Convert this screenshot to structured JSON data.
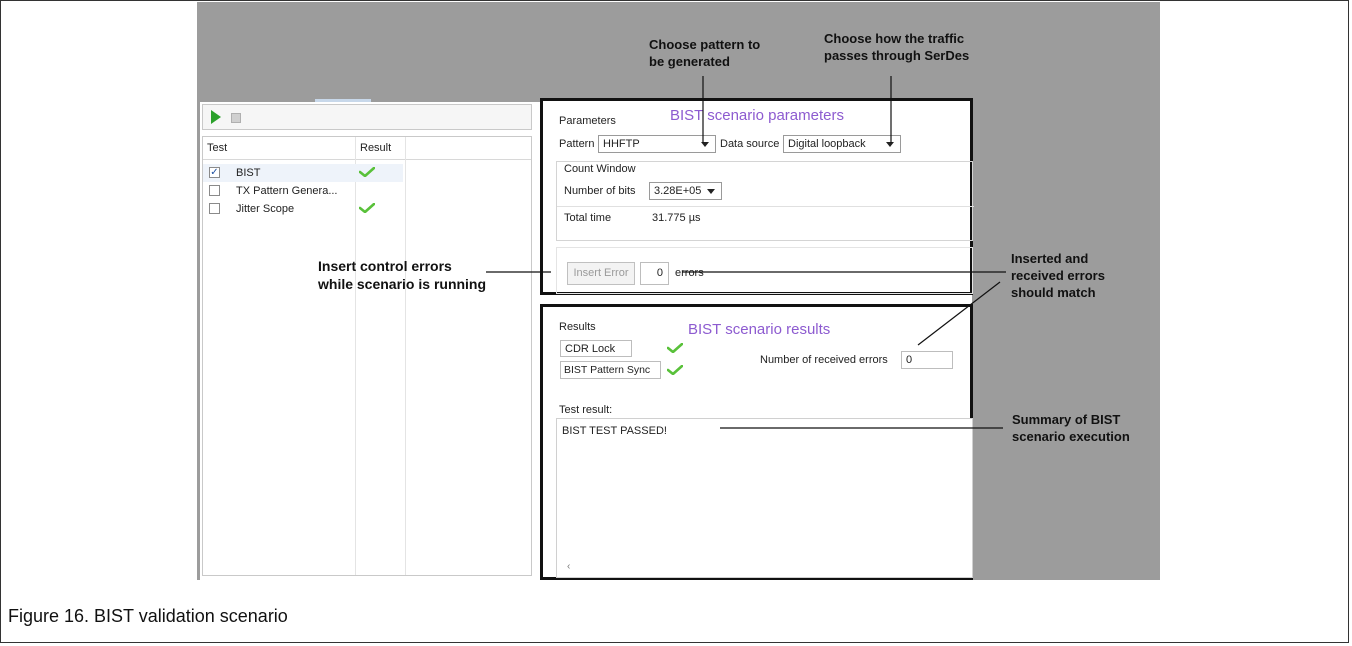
{
  "caption": "Figure 16.  BIST validation scenario",
  "annotations": {
    "choose_pattern": [
      "Choose pattern to",
      "be generated"
    ],
    "choose_traffic": [
      "Choose how the traffic",
      "passes through SerDes"
    ],
    "insert_control": [
      "Insert control errors",
      "while scenario is running"
    ],
    "inserted_received": [
      "Inserted and",
      "received errors",
      "should match"
    ],
    "summary": [
      "Summary of BIST",
      "scenario execution"
    ]
  },
  "test_panel": {
    "col_test": "Test",
    "col_result": "Result",
    "rows": [
      {
        "name": "BIST",
        "checked": true,
        "result": "pass"
      },
      {
        "name": "TX Pattern Genera...",
        "checked": false,
        "result": ""
      },
      {
        "name": "Jitter Scope",
        "checked": false,
        "result": "pass"
      }
    ]
  },
  "parameters": {
    "section_label": "Parameters",
    "title": "BIST scenario parameters",
    "pattern_label": "Pattern",
    "pattern_value": "HHFTP",
    "data_source_label": "Data source",
    "data_source_value": "Digital loopback",
    "count_window_label": "Count Window",
    "num_bits_label": "Number of bits",
    "num_bits_value": "3.28E+05",
    "total_time_label": "Total time",
    "total_time_value": "31.775 µs",
    "insert_error_button": "Insert Error",
    "errors_count": "0",
    "errors_label": "errors"
  },
  "results": {
    "section_label": "Results",
    "title": "BIST scenario results",
    "cdr_lock_label": "CDR Lock",
    "pattern_sync_label": "BIST Pattern Sync",
    "received_errors_label": "Number of received errors",
    "received_errors_value": "0",
    "test_result_label": "Test result:",
    "test_result_text": "BIST TEST PASSED!",
    "scroll_left_glyph": "‹"
  },
  "colors": {
    "check_green": "#59c13a",
    "title_purple": "#8d5bd0",
    "gray_background": "#9c9c9c"
  }
}
